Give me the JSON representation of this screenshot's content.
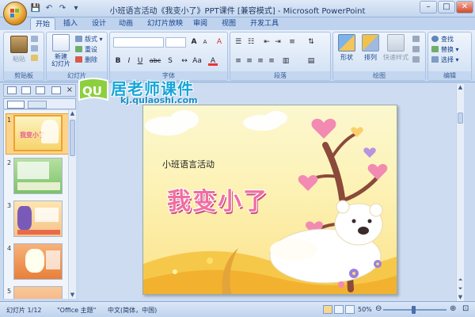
{
  "window": {
    "title": "小班语言活动《我变小了》PPT课件 [兼容模式] - Microsoft PowerPoint"
  },
  "tabs": [
    "开始",
    "插入",
    "设计",
    "动画",
    "幻灯片放映",
    "审阅",
    "视图",
    "开发工具"
  ],
  "ribbon": {
    "clipboard": {
      "label": "剪贴板",
      "paste": "粘贴"
    },
    "slides": {
      "label": "幻灯片",
      "new_slide": "新建\n幻灯片",
      "layout": "版式",
      "reset": "重设",
      "delete": "删除"
    },
    "font": {
      "label": "字体",
      "bold": "B",
      "italic": "I",
      "underline": "U",
      "strike": "abc",
      "shadow": "S",
      "size_up": "A",
      "size_down": "A",
      "clear": "A"
    },
    "paragraph": {
      "label": "段落"
    },
    "drawing": {
      "label": "绘图",
      "shapes": "形状",
      "arrange": "排列",
      "quick_styles": "快速样式"
    },
    "editing": {
      "label": "编辑",
      "find": "查找",
      "replace": "替换",
      "select": "选择"
    }
  },
  "thumbnails": [
    {
      "num": "1",
      "title": "我变小了"
    },
    {
      "num": "2"
    },
    {
      "num": "3"
    },
    {
      "num": "4"
    },
    {
      "num": "5"
    }
  ],
  "slide": {
    "subtitle": "小班语言活动",
    "title": "我变小了"
  },
  "watermark": {
    "brand": "居老师课件",
    "logo_text": "QU",
    "url": "kj.qulaoshi.com"
  },
  "status": {
    "slide_index": "幻灯片 1/12",
    "theme": "\"Office 主题\"",
    "language": "中文(简体，中国)",
    "zoom": "50%",
    "zoom_value": 50
  },
  "colors": {
    "ribbon_blue": "#15428b",
    "title_pink": "#f06ea0",
    "watermark_blue": "#16a5d8",
    "selected_thumb": "#f0a030"
  }
}
